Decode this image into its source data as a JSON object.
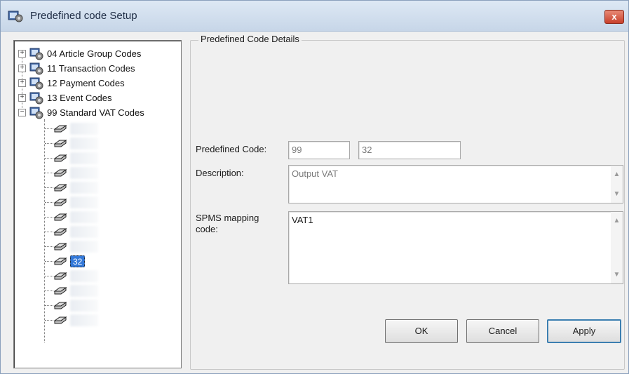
{
  "window": {
    "title": "Predefined code Setup",
    "close_label": "x"
  },
  "tree": {
    "roots": [
      {
        "label": "04 Article Group Codes",
        "expander": "+"
      },
      {
        "label": "11 Transaction Codes",
        "expander": "+"
      },
      {
        "label": "12 Payment Codes",
        "expander": "+"
      },
      {
        "label": "13 Event Codes",
        "expander": "+"
      },
      {
        "label": "99 Standard VAT Codes",
        "expander": "−"
      }
    ],
    "children": [
      "",
      "",
      "",
      "",
      "",
      "",
      "",
      "",
      "",
      "32",
      "",
      "",
      "",
      ""
    ],
    "selected_child": "32"
  },
  "details": {
    "group_title": "Predefined Code Details",
    "predefined_code_label": "Predefined Code:",
    "predefined_code_group": "99",
    "predefined_code_value": "32",
    "description_label": "Description:",
    "description_value": "Output VAT",
    "spms_label_line1": "SPMS mapping",
    "spms_label_line2": "code:",
    "spms_value": "VAT1"
  },
  "buttons": {
    "ok": "OK",
    "cancel": "Cancel",
    "apply": "Apply"
  },
  "colors": {
    "selection": "#3378d8",
    "titlebar": "#c7d6e8",
    "close": "#c8402c"
  }
}
